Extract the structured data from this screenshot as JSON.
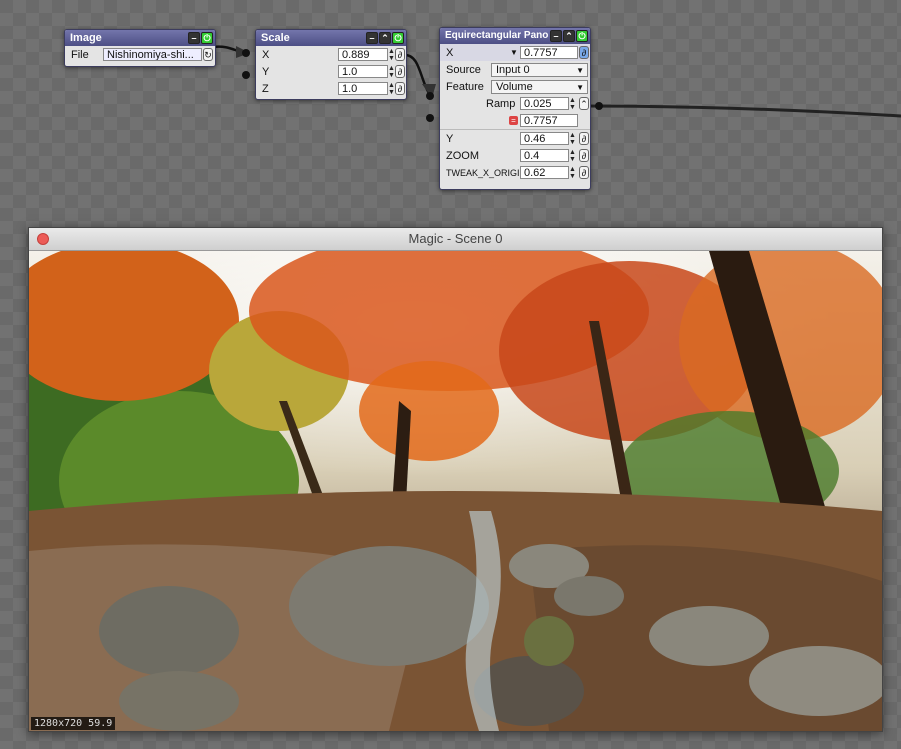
{
  "nodes": {
    "image": {
      "title": "Image",
      "file_label": "File",
      "file_value": "Nishinomiya-shi..."
    },
    "scale": {
      "title": "Scale",
      "x_label": "X",
      "x_value": "0.889",
      "y_label": "Y",
      "y_value": "1.0",
      "z_label": "Z",
      "z_value": "1.0"
    },
    "pano": {
      "title": "Equirectangular Pano V...",
      "x_label": "X",
      "x_value": "0.7757",
      "source_label": "Source",
      "source_value": "Input 0",
      "feature_label": "Feature",
      "feature_value": "Volume",
      "ramp_label": "Ramp",
      "ramp_value": "0.025",
      "ramp_value2": "0.7757",
      "y_label": "Y",
      "y_value": "0.46",
      "zoom_label": "ZOOM",
      "zoom_value": "0.4",
      "tweak_label": "TWEAK_X_ORIGIN",
      "tweak_value": "0.62"
    }
  },
  "window": {
    "title": "Magic - Scene 0",
    "status": "1280x720  59.9"
  },
  "colors": {
    "node_header": "#5c5e96",
    "close_button": "#ec5b57"
  }
}
